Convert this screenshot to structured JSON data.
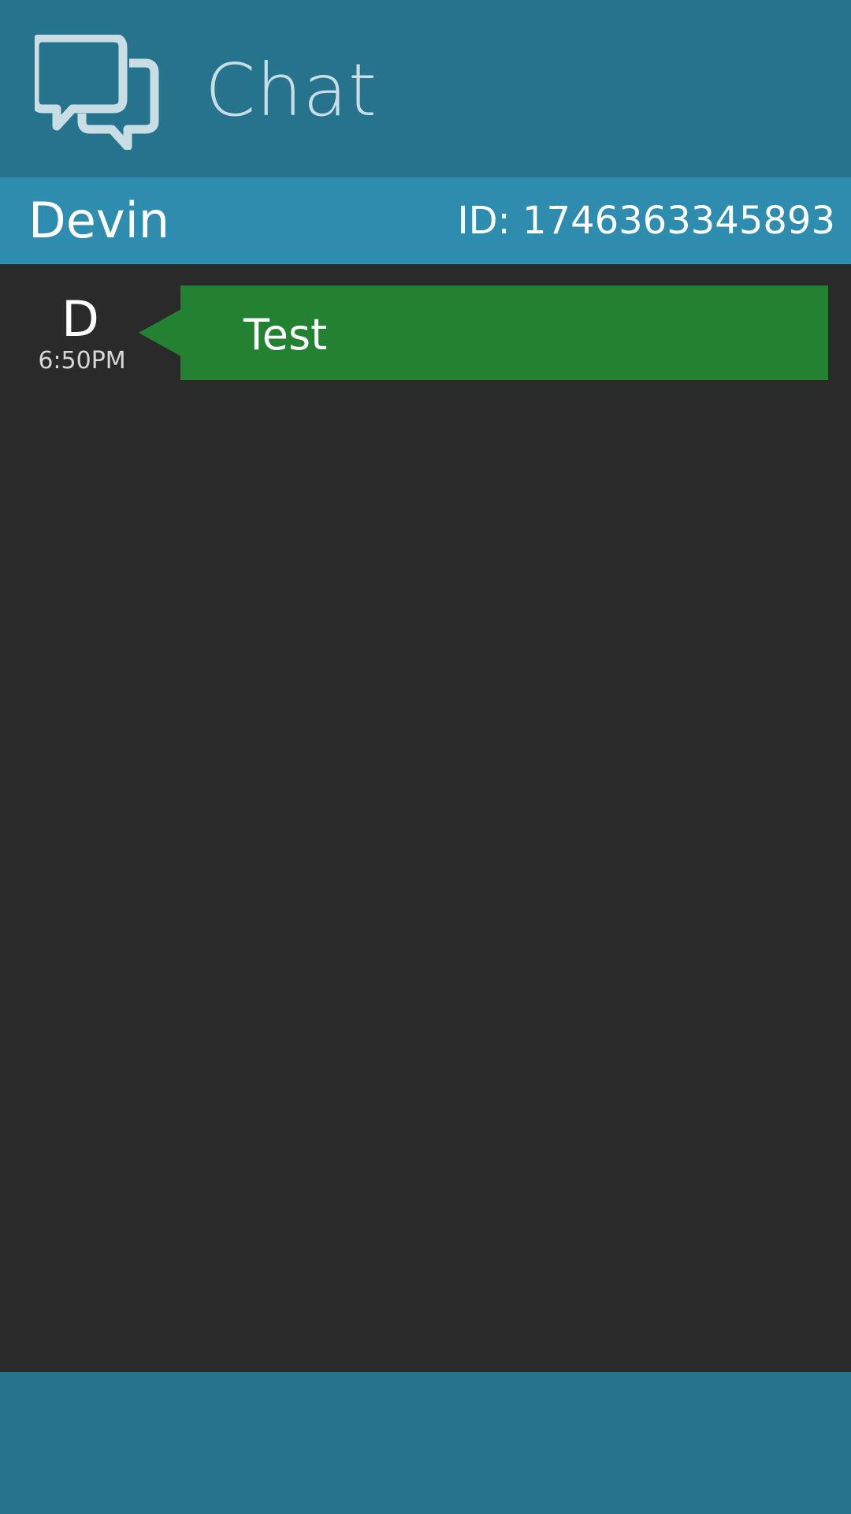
{
  "header": {
    "icon": "chat-bubbles-icon",
    "title": "Chat"
  },
  "contact": {
    "name": "Devin",
    "id_label": "ID: 1746363345893"
  },
  "messages": [
    {
      "sender_initial": "D",
      "time": "6:50PM",
      "text": "Test"
    }
  ],
  "colors": {
    "header_bg": "#25738c",
    "contact_bar_bg": "#2e8caf",
    "chat_bg": "#2a2a2a",
    "bubble_bg": "#238232",
    "icon_color": "#c9dde5"
  }
}
